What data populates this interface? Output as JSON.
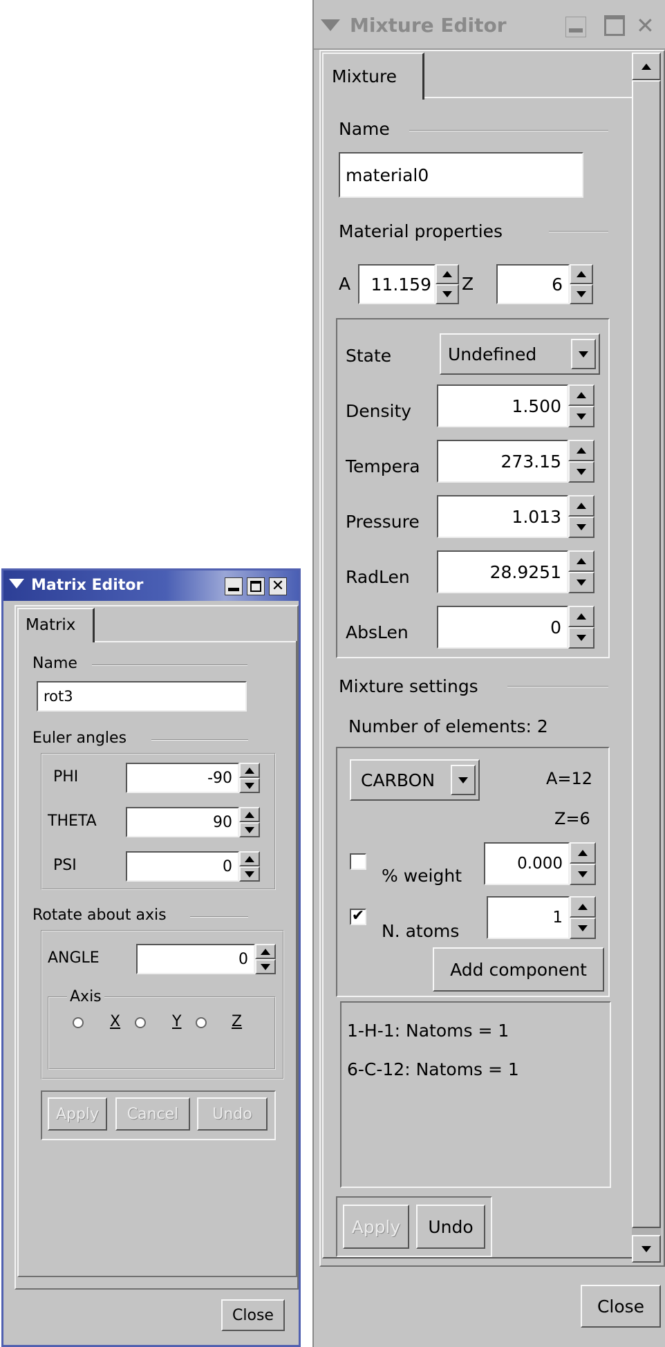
{
  "matrix_editor": {
    "title": "Matrix Editor",
    "tab": "Matrix",
    "name_label": "Name",
    "name_value": "rot3",
    "euler_label": "Euler angles",
    "phi_label": "PHI",
    "phi_value": "-90",
    "theta_label": "THETA",
    "theta_value": "90",
    "psi_label": "PSI",
    "psi_value": "0",
    "rotate_label": "Rotate about axis",
    "angle_label": "ANGLE",
    "angle_value": "0",
    "axis_label": "Axis",
    "axis_x": "X",
    "axis_y": "Y",
    "axis_z": "Z",
    "apply": "Apply",
    "cancel": "Cancel",
    "undo": "Undo",
    "close": "Close"
  },
  "mixture_editor": {
    "title": "Mixture Editor",
    "tab": "Mixture",
    "name_label": "Name",
    "name_value": "material0",
    "props_label": "Material properties",
    "a_label": "A",
    "a_value": "11.159",
    "z_label": "Z",
    "z_value": "6",
    "state_label": "State",
    "state_value": "Undefined",
    "density_label": "Density",
    "density_value": "1.500",
    "temp_label": "Tempera",
    "temp_value": "273.15",
    "pressure_label": "Pressure",
    "pressure_value": "1.013",
    "radlen_label": "RadLen",
    "radlen_value": "28.9251",
    "abslen_label": "AbsLen",
    "abslen_value": "0",
    "settings_label": "Mixture settings",
    "num_elements": "Number of elements: 2",
    "element_value": "CARBON",
    "element_a": "A=12",
    "element_z": "Z=6",
    "weight_label": "% weight",
    "weight_value": "0.000",
    "weight_checked": false,
    "natoms_label": "N. atoms",
    "natoms_value": "1",
    "natoms_checked": true,
    "add_component": "Add component",
    "components": [
      "1-H-1: Natoms = 1",
      "6-C-12: Natoms = 1"
    ],
    "apply": "Apply",
    "undo": "Undo",
    "close": "Close"
  },
  "colors": {
    "titlebar": "#3a4fa0",
    "titlebar_inactive": "#c4c4c4",
    "panel": "#c4c4c4"
  }
}
